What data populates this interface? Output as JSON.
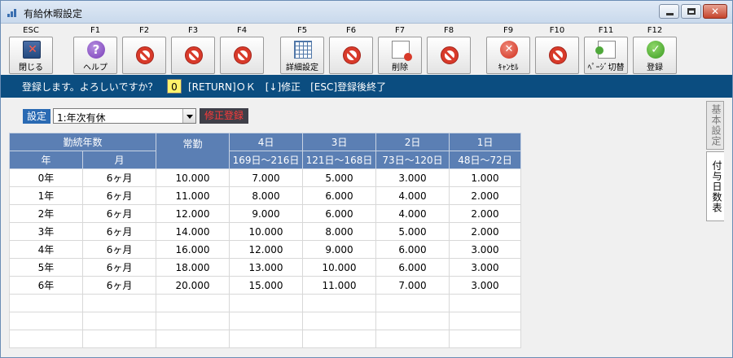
{
  "window": {
    "title": "有給休暇設定"
  },
  "toolbar": {
    "keys": [
      {
        "key": "ESC",
        "label": "閉じる",
        "icon": "close-window-icon"
      },
      {
        "key": "F1",
        "label": "ヘルプ",
        "icon": "help-icon"
      },
      {
        "key": "F2",
        "label": "",
        "icon": "prohibit-icon"
      },
      {
        "key": "F3",
        "label": "",
        "icon": "prohibit-icon"
      },
      {
        "key": "F4",
        "label": "",
        "icon": "prohibit-icon"
      },
      {
        "key": "F5",
        "label": "詳細設定",
        "icon": "grid-settings-icon"
      },
      {
        "key": "F6",
        "label": "",
        "icon": "prohibit-icon"
      },
      {
        "key": "F7",
        "label": "削除",
        "icon": "delete-document-icon"
      },
      {
        "key": "F8",
        "label": "",
        "icon": "prohibit-icon"
      },
      {
        "key": "F9",
        "label": "ｷｬﾝｾﾙ",
        "icon": "cancel-icon"
      },
      {
        "key": "F10",
        "label": "",
        "icon": "prohibit-icon"
      },
      {
        "key": "F11",
        "label": "ﾍﾟｰｼﾞ切替",
        "icon": "page-switch-icon"
      },
      {
        "key": "F12",
        "label": "登録",
        "icon": "register-check-icon"
      }
    ]
  },
  "prompt": {
    "text": "登録します。よろしいですか？",
    "value": "0",
    "hint": "[RETURN]ＯＫ　[↓]修正　[ESC]登録後終了"
  },
  "setting": {
    "label": "設定",
    "selected": "1:年次有休",
    "badge": "修正登録"
  },
  "table": {
    "header_top": {
      "service_years": "勤続年数",
      "regular": "常勤",
      "d4": "4日",
      "d3": "3日",
      "d2": "2日",
      "d1": "1日"
    },
    "header_sub": {
      "year": "年",
      "month": "月",
      "d4": "169日～216日",
      "d3": "121日～168日",
      "d2": "73日～120日",
      "d1": "48日～72日"
    },
    "rows": [
      [
        "0年",
        "6ヶ月",
        "10.000",
        "7.000",
        "5.000",
        "3.000",
        "1.000"
      ],
      [
        "1年",
        "6ヶ月",
        "11.000",
        "8.000",
        "6.000",
        "4.000",
        "2.000"
      ],
      [
        "2年",
        "6ヶ月",
        "12.000",
        "9.000",
        "6.000",
        "4.000",
        "2.000"
      ],
      [
        "3年",
        "6ヶ月",
        "14.000",
        "10.000",
        "8.000",
        "5.000",
        "2.000"
      ],
      [
        "4年",
        "6ヶ月",
        "16.000",
        "12.000",
        "9.000",
        "6.000",
        "3.000"
      ],
      [
        "5年",
        "6ヶ月",
        "18.000",
        "13.000",
        "10.000",
        "6.000",
        "3.000"
      ],
      [
        "6年",
        "6ヶ月",
        "20.000",
        "15.000",
        "11.000",
        "7.000",
        "3.000"
      ],
      [
        "",
        "",
        "",
        "",
        "",
        "",
        ""
      ],
      [
        "",
        "",
        "",
        "",
        "",
        "",
        ""
      ],
      [
        "",
        "",
        "",
        "",
        "",
        "",
        ""
      ]
    ]
  },
  "tabs": {
    "basic": "基本設定",
    "grant_days": "付与日数表"
  }
}
